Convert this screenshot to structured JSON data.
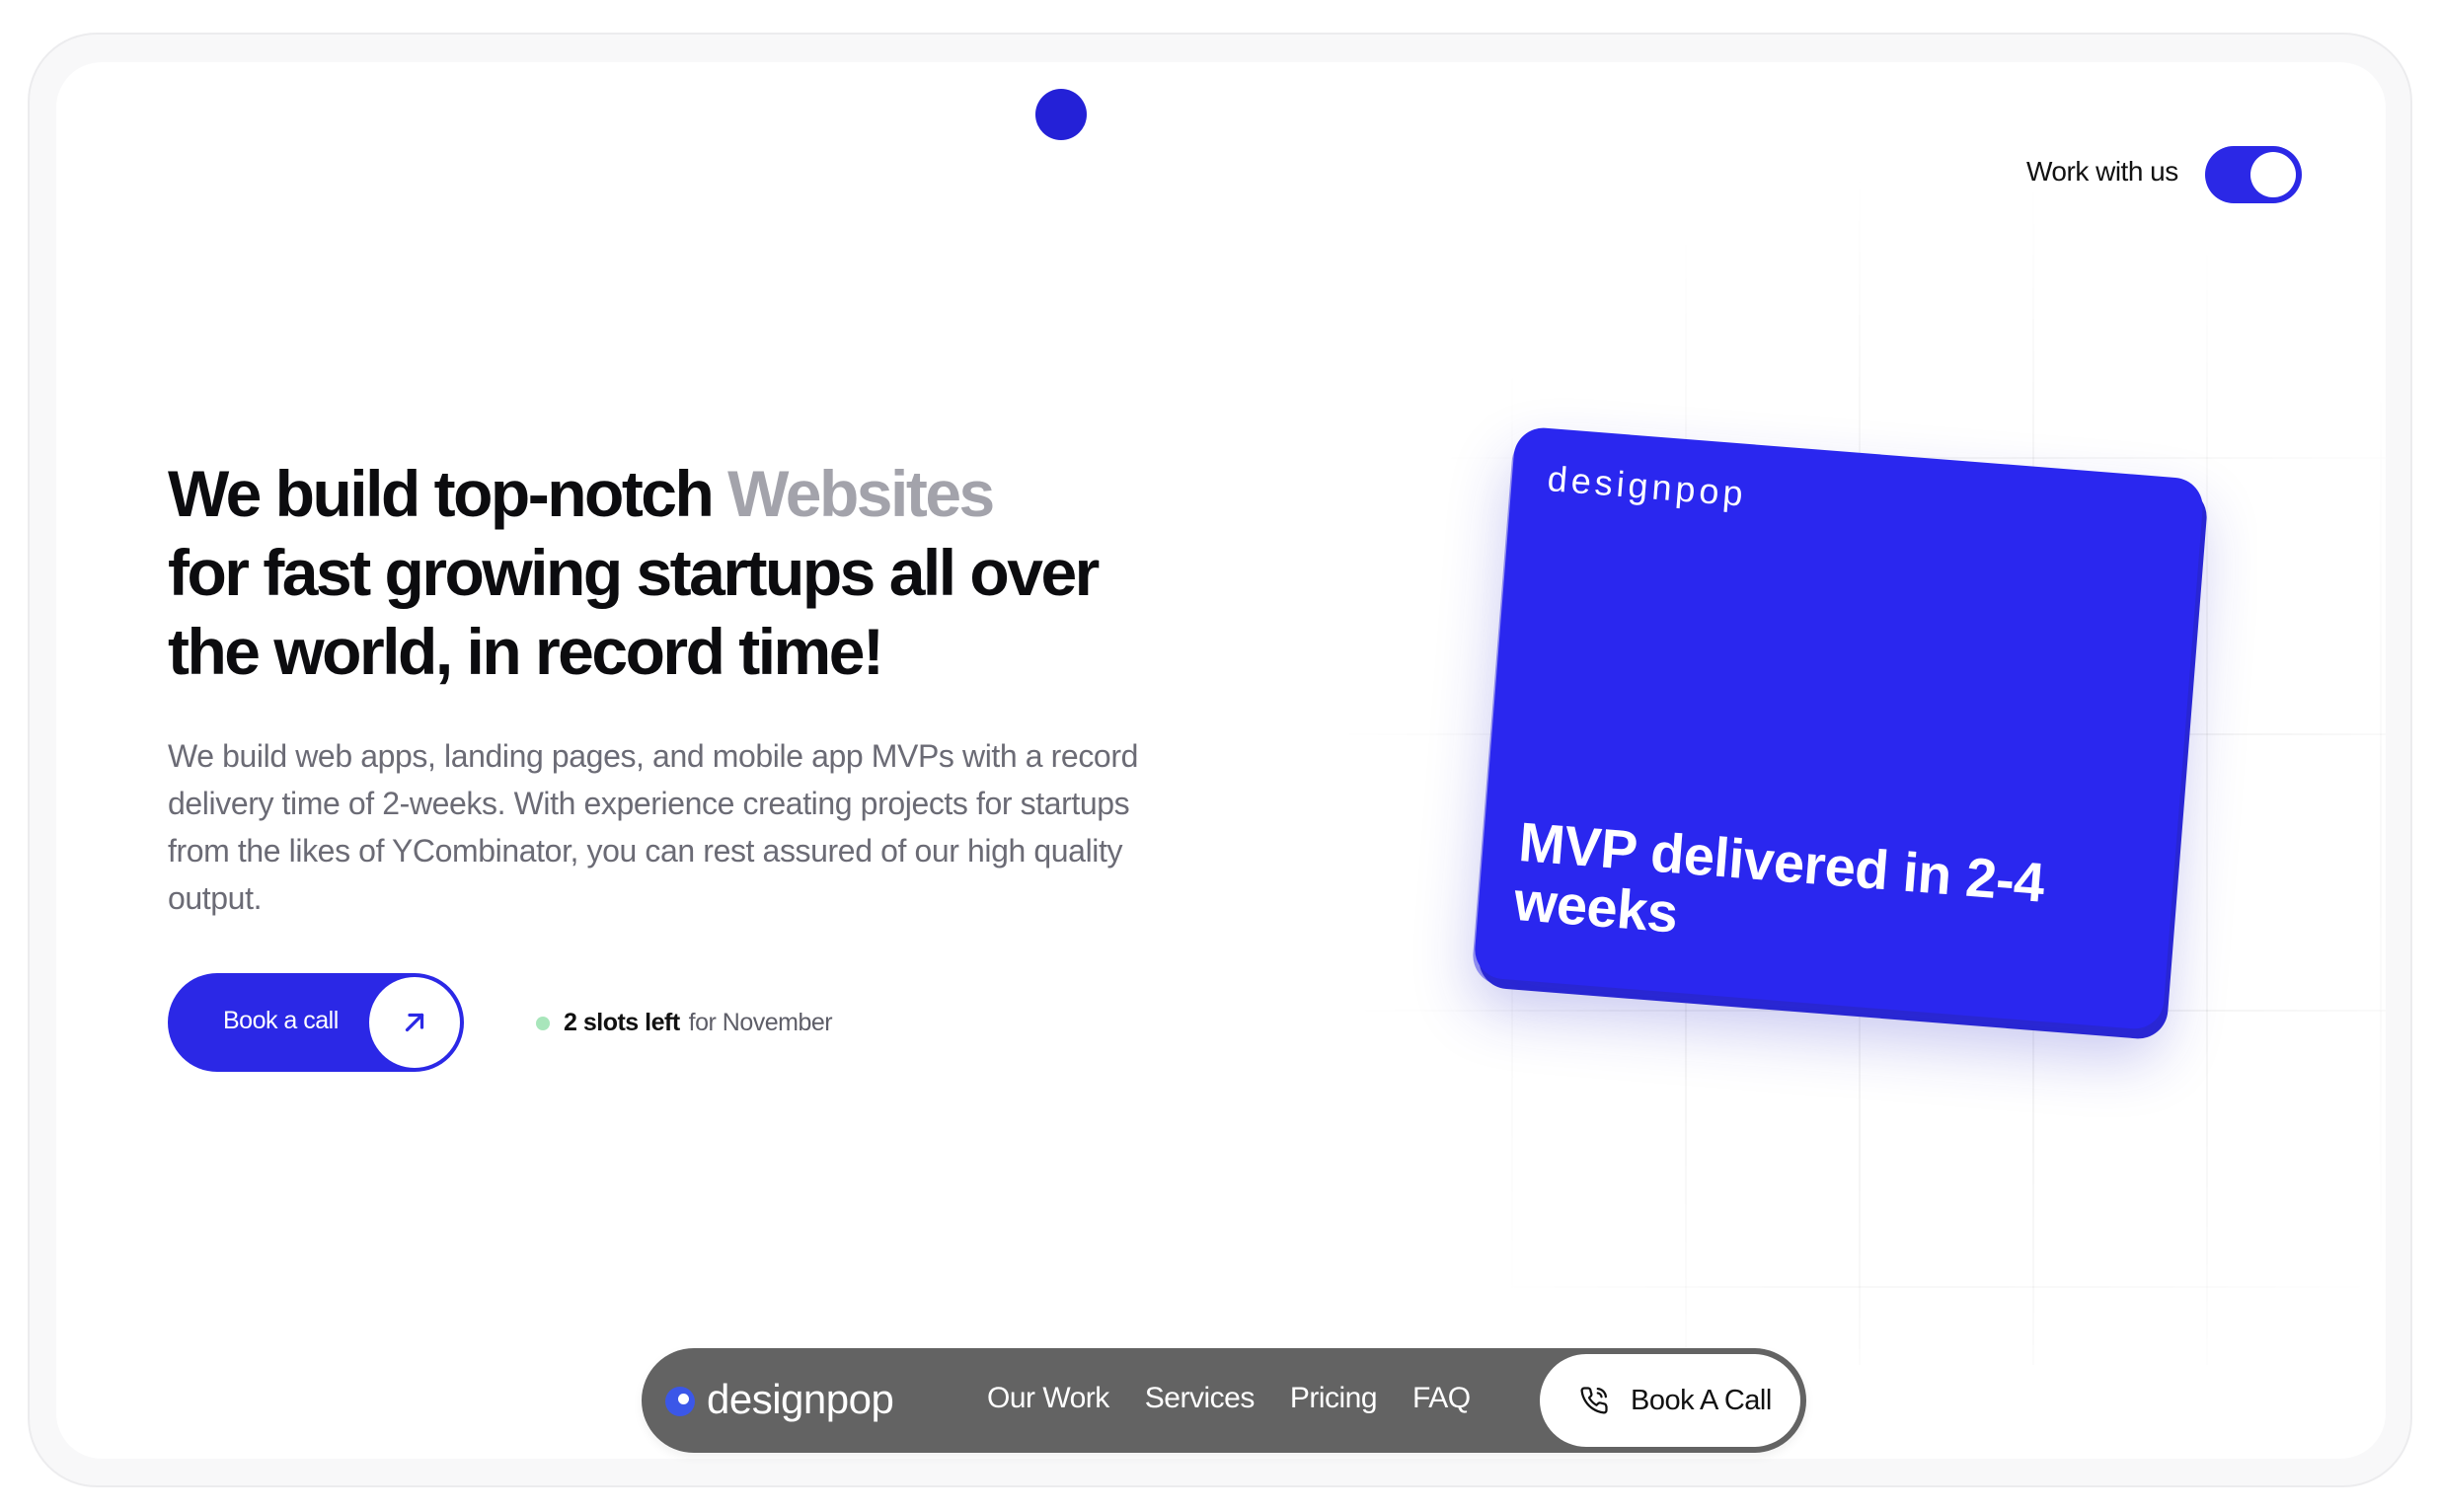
{
  "header": {
    "work_label": "Work with us",
    "toggle_on": true
  },
  "hero": {
    "headline_part1": "We build top-notch ",
    "headline_accent": "Websites",
    "headline_line2": "for fast growing startups all over",
    "headline_line3": "the world, in record time!",
    "description": "We build web apps, landing pages, and mobile app MVPs with a record delivery time of 2-weeks. With experience creating projects for startups from the likes of YCombinator, you can rest assured of our high quality output.",
    "cta_label": "Book a call",
    "slots_bold": "2 slots left",
    "slots_rest": "for November"
  },
  "card": {
    "brand": "designpop",
    "title": "MVP delivered in 2-4 weeks"
  },
  "nav": {
    "logo": "designpop",
    "links": [
      "Our Work",
      "Services",
      "Pricing",
      "FAQ"
    ],
    "cta_label": "Book A Call"
  },
  "colors": {
    "accent": "#2b28e6",
    "muted_headline": "#a3a3ab",
    "nav_bg": "#636363",
    "slot_dot": "#a8e6bb"
  },
  "icons": {
    "cta": "arrow-up-right-icon",
    "nav_cta": "phone-icon",
    "logo": "logo-dot-icon"
  }
}
